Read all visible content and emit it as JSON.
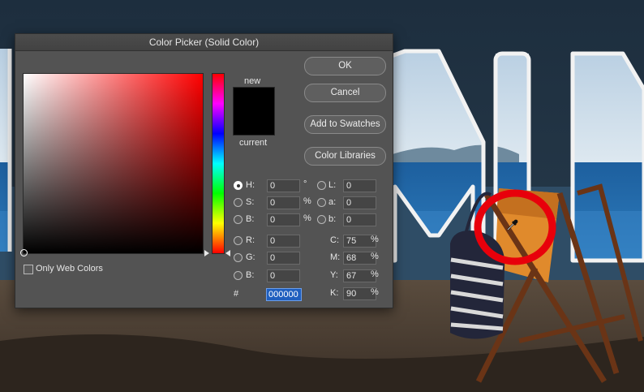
{
  "dialog": {
    "title": "Color Picker (Solid Color)",
    "swatch_new_label": "new",
    "swatch_current_label": "current",
    "buttons": {
      "ok": "OK",
      "cancel": "Cancel",
      "add_to_swatches": "Add to Swatches",
      "color_libraries": "Color Libraries"
    },
    "only_web_colors": "Only Web Colors",
    "hsb": [
      {
        "label": "H:",
        "value": "0",
        "unit": "°"
      },
      {
        "label": "S:",
        "value": "0",
        "unit": "%"
      },
      {
        "label": "B:",
        "value": "0",
        "unit": "%"
      }
    ],
    "rgb": [
      {
        "label": "R:",
        "value": "0"
      },
      {
        "label": "G:",
        "value": "0"
      },
      {
        "label": "B:",
        "value": "0"
      }
    ],
    "lab": [
      {
        "label": "L:",
        "value": "0"
      },
      {
        "label": "a:",
        "value": "0"
      },
      {
        "label": "b:",
        "value": "0"
      }
    ],
    "cmyk": [
      {
        "label": "C:",
        "value": "75",
        "unit": "%"
      },
      {
        "label": "M:",
        "value": "68",
        "unit": "%"
      },
      {
        "label": "Y:",
        "value": "67",
        "unit": "%"
      },
      {
        "label": "K:",
        "value": "90",
        "unit": "%"
      }
    ],
    "hex_label": "#",
    "hex_value": "000000"
  },
  "colors": {
    "dialog_bg": "#535353",
    "new_swatch": "#000000",
    "hex_highlight": "#1f5fbf",
    "highlight_circle": "#e8000b"
  },
  "icons": {
    "eyedropper": "eyedropper-icon"
  }
}
